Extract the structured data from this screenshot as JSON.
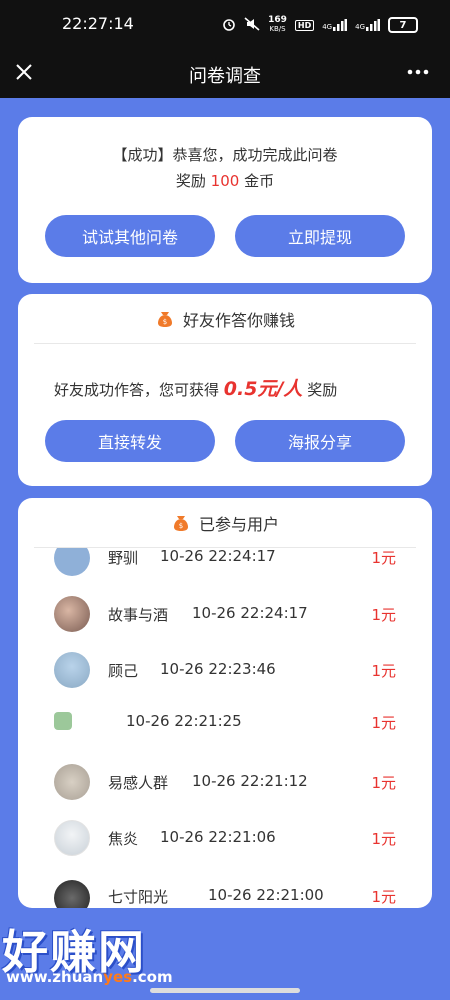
{
  "status_bar": {
    "time": "22:27:14",
    "net_speed_value": "169",
    "net_speed_unit": "KB/S",
    "hd_label": "HD",
    "signal1": "4G",
    "signal2": "4G",
    "battery": "7"
  },
  "nav": {
    "title": "问卷调查"
  },
  "result_card": {
    "success_tag": "【成功】",
    "success_text": "恭喜您，成功完成此问卷",
    "reward_prefix": "奖励",
    "reward_amount": "100",
    "reward_unit": "金币",
    "btn_other": "试试其他问卷",
    "btn_withdraw": "立即提现"
  },
  "invite_card": {
    "title": "好友作答你赚钱",
    "text_prefix": "好友成功作答，您可获得",
    "amount": "0.5元/人",
    "text_suffix": "奖励",
    "btn_forward": "直接转发",
    "btn_poster": "海报分享"
  },
  "participants": {
    "title": "已参与用户",
    "rows": [
      {
        "name": "野驯",
        "time": "10-26 22:24:17",
        "amount": "1元"
      },
      {
        "name": "故事与酒",
        "time": "10-26 22:24:17",
        "amount": "1元"
      },
      {
        "name": "顾己",
        "time": "10-26 22:23:46",
        "amount": "1元"
      },
      {
        "name": "",
        "time": "10-26 22:21:25",
        "amount": "1元"
      },
      {
        "name": "易感人群",
        "time": "10-26 22:21:12",
        "amount": "1元"
      },
      {
        "name": "焦炎",
        "time": "10-26 22:21:06",
        "amount": "1元"
      },
      {
        "name": "七寸阳光",
        "time": "10-26 22:21:00",
        "amount": "1元"
      }
    ]
  },
  "watermark": {
    "big": "好赚网",
    "url_a": "www.zhuan",
    "url_b": "yes",
    "url_c": ".com"
  },
  "colors": {
    "accent": "#5b7ce8",
    "red": "#e8332f",
    "icon_orange": "#f07a2a"
  }
}
